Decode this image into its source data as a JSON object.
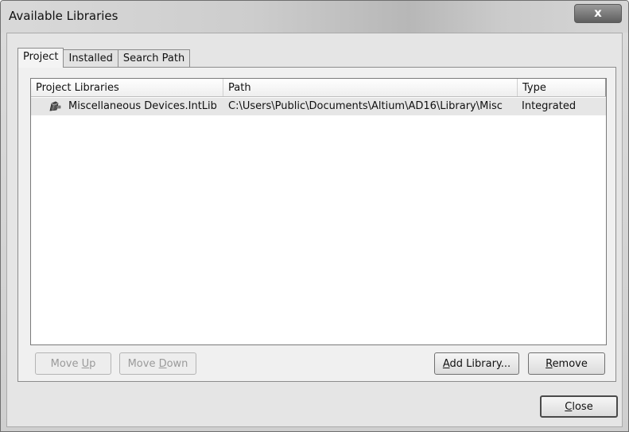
{
  "window": {
    "title": "Available Libraries",
    "close_glyph": "x"
  },
  "tabs": [
    {
      "label": "Project",
      "active": true
    },
    {
      "label": "Installed",
      "active": false
    },
    {
      "label": "Search Path",
      "active": false
    }
  ],
  "list": {
    "columns": [
      "Project Libraries",
      "Path",
      "Type"
    ],
    "rows": [
      {
        "icon": "integrated-library-icon",
        "name": "Miscellaneous Devices.IntLib",
        "path": "C:\\Users\\Public\\Documents\\Altium\\AD16\\Library\\Misc",
        "type": "Integrated"
      }
    ]
  },
  "buttons": {
    "move_up": {
      "pre": "Move ",
      "key": "U",
      "post": "p"
    },
    "move_down": {
      "pre": "Move ",
      "key": "D",
      "post": "own"
    },
    "add_library": {
      "pre": "",
      "key": "A",
      "post": "dd Library..."
    },
    "remove": {
      "pre": "",
      "key": "R",
      "post": "emove"
    },
    "close": {
      "pre": "",
      "key": "C",
      "post": "lose"
    }
  }
}
